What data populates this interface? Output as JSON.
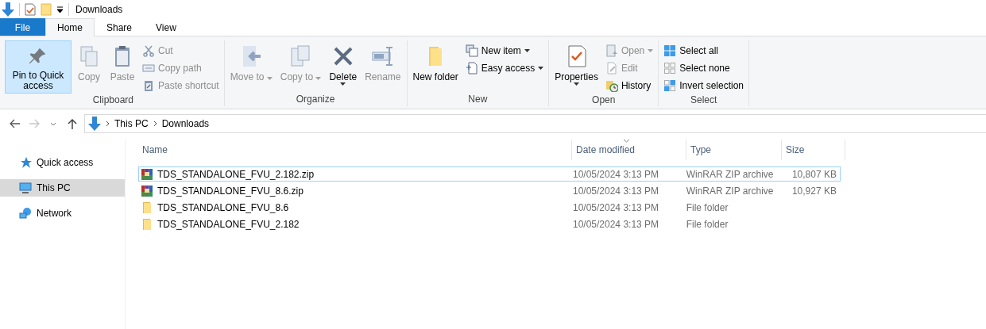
{
  "window": {
    "title": "Downloads"
  },
  "tabs": [
    {
      "label": "File",
      "kind": "file",
      "selected": false
    },
    {
      "label": "Home",
      "kind": "tab",
      "selected": true
    },
    {
      "label": "Share",
      "kind": "tab",
      "selected": false
    },
    {
      "label": "View",
      "kind": "tab",
      "selected": false
    }
  ],
  "ribbon": {
    "groups": [
      {
        "label": "Clipboard",
        "items": [
          {
            "kind": "large",
            "label": "Pin to Quick access",
            "disabled": false,
            "highlighted": true
          },
          {
            "kind": "large",
            "label": "Copy",
            "disabled": true,
            "highlighted": false
          },
          {
            "kind": "large",
            "label": "Paste",
            "disabled": true,
            "highlighted": false
          },
          {
            "kind": "small",
            "label": "Cut",
            "disabled": true
          },
          {
            "kind": "small",
            "label": "Copy path",
            "disabled": true
          },
          {
            "kind": "small",
            "label": "Paste shortcut",
            "disabled": true
          }
        ]
      },
      {
        "label": "Organize",
        "items": [
          {
            "kind": "large",
            "label": "Move to",
            "disabled": true,
            "highlighted": false,
            "dropdown": true,
            "split": false
          },
          {
            "kind": "large",
            "label": "Copy to",
            "disabled": true,
            "highlighted": false,
            "dropdown": true,
            "split": false
          },
          {
            "kind": "large",
            "label": "Delete",
            "disabled": false,
            "highlighted": false,
            "dropdown": true,
            "split": true
          },
          {
            "kind": "large",
            "label": "Rename",
            "disabled": true,
            "highlighted": false
          }
        ]
      },
      {
        "label": "New",
        "items": [
          {
            "kind": "large",
            "label": "New folder",
            "disabled": false,
            "highlighted": false
          },
          {
            "kind": "small",
            "label": "New item",
            "disabled": false,
            "dropdown": true
          },
          {
            "kind": "small",
            "label": "Easy access",
            "disabled": false,
            "dropdown": true
          }
        ]
      },
      {
        "label": "Open",
        "items": [
          {
            "kind": "large",
            "label": "Properties",
            "disabled": false,
            "highlighted": false,
            "dropdown": true,
            "split": true
          },
          {
            "kind": "small",
            "label": "Open",
            "disabled": true,
            "dropdown": true
          },
          {
            "kind": "small",
            "label": "Edit",
            "disabled": true
          },
          {
            "kind": "small",
            "label": "History",
            "disabled": false
          }
        ]
      },
      {
        "label": "Select",
        "items": [
          {
            "kind": "small",
            "label": "Select all",
            "disabled": false
          },
          {
            "kind": "small",
            "label": "Select none",
            "disabled": false
          },
          {
            "kind": "small",
            "label": "Invert selection",
            "disabled": false
          }
        ]
      }
    ]
  },
  "address": {
    "back_disabled": false,
    "forward_disabled": true,
    "path": [
      "This PC",
      "Downloads"
    ]
  },
  "sidebar": {
    "items": [
      {
        "label": "Quick access",
        "kind": "star",
        "selected": false
      },
      {
        "label": "This PC",
        "kind": "pc",
        "selected": true
      },
      {
        "label": "Network",
        "kind": "network",
        "selected": false
      }
    ]
  },
  "table": {
    "columns": [
      {
        "label": "Name",
        "sorted": false
      },
      {
        "label": "Date modified",
        "sorted": true
      },
      {
        "label": "Type",
        "sorted": false
      },
      {
        "label": "Size",
        "sorted": false
      }
    ],
    "rows": [
      {
        "kind": "archive",
        "name": "TDS_STANDALONE_FVU_2.182.zip",
        "date": "10/05/2024 3:13 PM",
        "type": "WinRAR ZIP archive",
        "size": "10,807 KB",
        "selected": true
      },
      {
        "kind": "archive",
        "name": "TDS_STANDALONE_FVU_8.6.zip",
        "date": "10/05/2024 3:13 PM",
        "type": "WinRAR ZIP archive",
        "size": "10,927 KB",
        "selected": false
      },
      {
        "kind": "folder",
        "name": "TDS_STANDALONE_FVU_8.6",
        "date": "10/05/2024 3:13 PM",
        "type": "File folder",
        "selected": false
      },
      {
        "kind": "folder",
        "name": "TDS_STANDALONE_FVU_2.182",
        "date": "10/05/2024 3:13 PM",
        "type": "File folder",
        "selected": false
      }
    ]
  }
}
